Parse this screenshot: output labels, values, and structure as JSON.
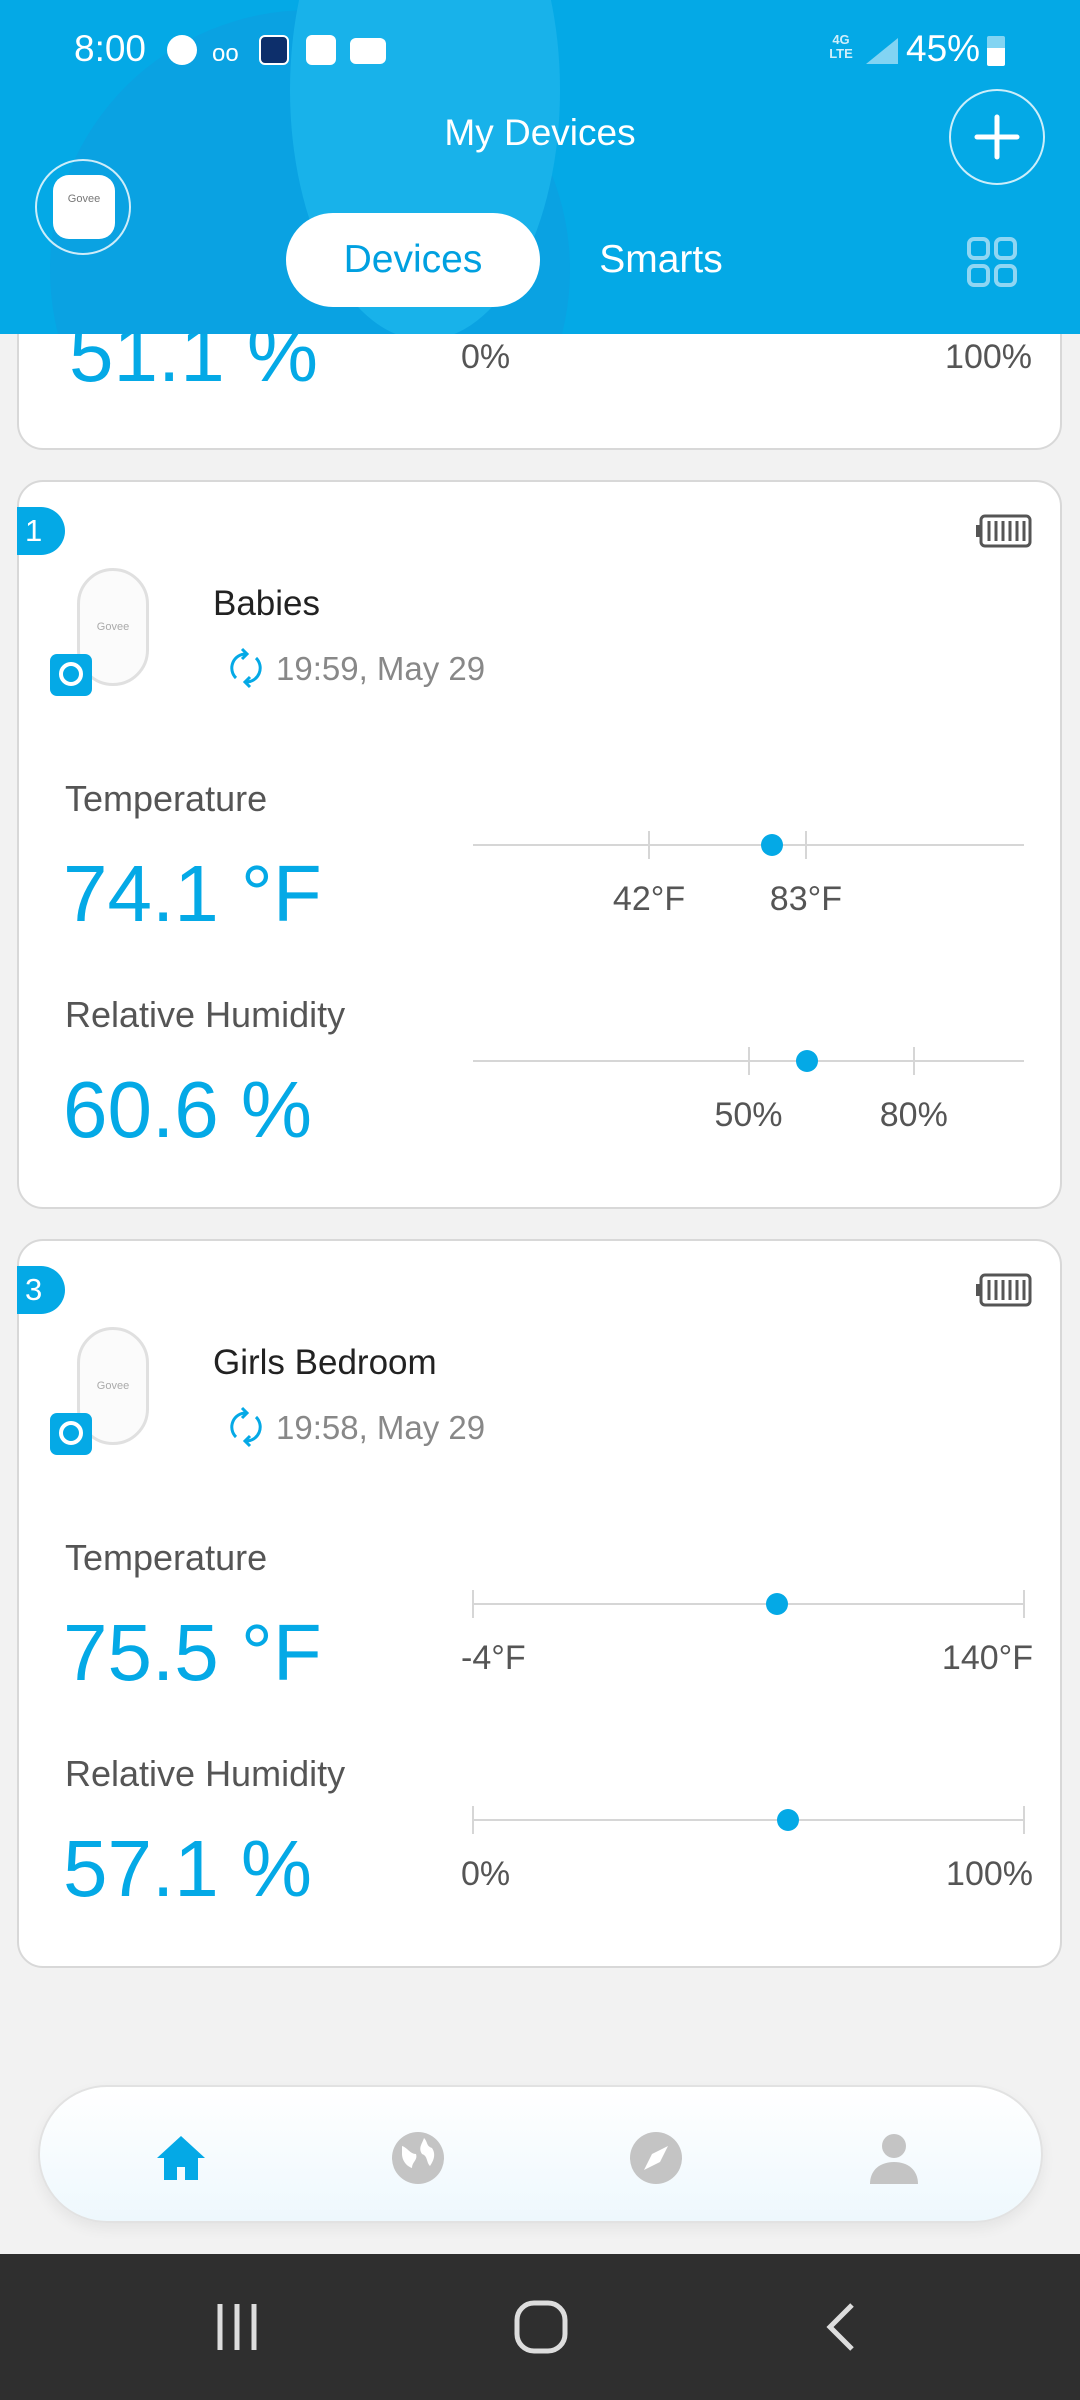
{
  "status_bar": {
    "time": "8:00",
    "battery": "45%",
    "network": "4G LTE"
  },
  "header": {
    "title": "My Devices",
    "avatar_label": "Govee",
    "tabs": [
      {
        "label": "Devices",
        "active": true
      },
      {
        "label": "Smarts",
        "active": false
      }
    ]
  },
  "colors": {
    "accent": "#04a9e6",
    "background": "#f2f2f2"
  },
  "partial_card": {
    "humidity": "51.1 %",
    "range_min": "0%",
    "range_max": "100%",
    "humidity_value": 51.1
  },
  "devices": [
    {
      "index": "1",
      "name": "Babies",
      "time": "19:59,  May 29",
      "image_label": "Govee",
      "temperature": {
        "label": "Temperature",
        "display": "74.1 °F",
        "value": 74.1,
        "ticks": [
          {
            "label": "42°F",
            "value": 42
          },
          {
            "label": "83°F",
            "value": 83
          }
        ]
      },
      "humidity": {
        "label": "Relative Humidity",
        "display": "60.6 %",
        "value": 60.6,
        "ticks": [
          {
            "label": "50%",
            "value": 50
          },
          {
            "label": "80%",
            "value": 80
          }
        ]
      }
    },
    {
      "index": "3",
      "name": "Girls Bedroom",
      "time": "19:58,  May 29",
      "image_label": "Govee",
      "temperature": {
        "label": "Temperature",
        "display": "75.5 °F",
        "value": 75.5,
        "ticks": [
          {
            "label": "-4°F",
            "value": -4
          },
          {
            "label": "140°F",
            "value": 140
          }
        ]
      },
      "humidity": {
        "label": "Relative Humidity",
        "display": "57.1 %",
        "value": 57.1,
        "ticks": [
          {
            "label": "0%",
            "value": 0
          },
          {
            "label": "100%",
            "value": 100
          }
        ]
      }
    }
  ],
  "bottom_nav": [
    {
      "icon": "home-icon",
      "active": true
    },
    {
      "icon": "globe-icon",
      "active": false
    },
    {
      "icon": "compass-icon",
      "active": false
    },
    {
      "icon": "profile-icon",
      "active": false
    }
  ],
  "system_nav": [
    "recents",
    "home",
    "back"
  ]
}
